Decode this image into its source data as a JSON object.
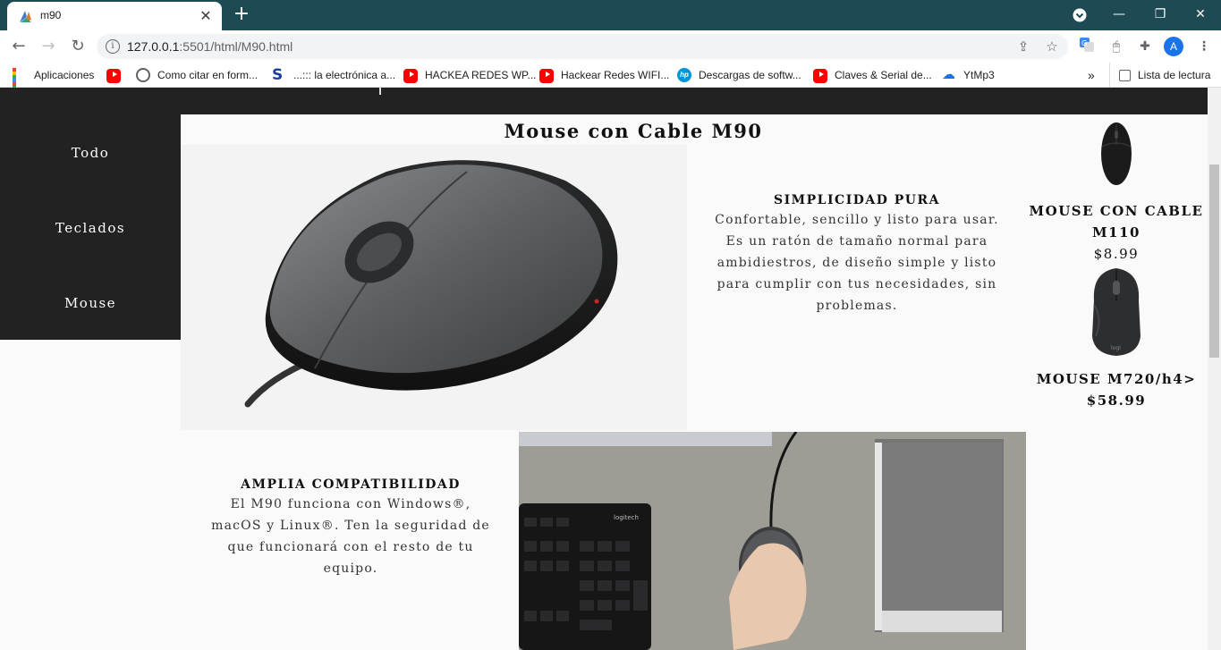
{
  "browser": {
    "tab_title": "m90",
    "url_host": "127.0.0.1",
    "url_rest": ":5501/html/M90.html",
    "profile_initial": "A",
    "bookmarks": [
      {
        "label": "Aplicaciones",
        "icon": "apps-grid-icon"
      },
      {
        "label": "",
        "icon": "youtube-icon"
      },
      {
        "label": "Como citar en form...",
        "icon": "globe-icon"
      },
      {
        "label": "...::: la electrónica a...",
        "icon": "s-logo-icon"
      },
      {
        "label": "HACKEA REDES WP...",
        "icon": "youtube-icon"
      },
      {
        "label": "Hackear Redes WIFI...",
        "icon": "youtube-icon"
      },
      {
        "label": "Descargas de softw...",
        "icon": "hp-icon"
      },
      {
        "label": "Claves & Serial de...",
        "icon": "youtube-icon"
      },
      {
        "label": "YtMp3",
        "icon": "cloud-download-icon"
      }
    ],
    "reading_list": "Lista de lectura"
  },
  "sidenav": {
    "items": [
      "Todo",
      "Teclados",
      "Mouse"
    ]
  },
  "product": {
    "title": "Mouse con Cable M90",
    "feature1": {
      "title": "SIMPLICIDAD PURA",
      "text": "Confortable, sencillo y listo para usar. Es un ratón de tamaño normal para ambidiestros, de diseño simple y listo para cumplir con tus necesidades, sin problemas."
    },
    "feature2": {
      "title": "AMPLIA COMPATIBILIDAD",
      "text": "El M90 funciona con Windows®, macOS y Linux®. Ten la seguridad de que funcionará con el resto de tu equipo."
    }
  },
  "related": [
    {
      "name": "MOUSE CON CABLE M110",
      "price": "$8.99"
    },
    {
      "name": "MOUSE M720/h4>",
      "price": "$58.99"
    }
  ],
  "keyboard_brand": "logitech",
  "colors": {
    "tabstrip": "#1e4a54",
    "nav_bg": "#222222",
    "page_bg": "#fafafa"
  }
}
